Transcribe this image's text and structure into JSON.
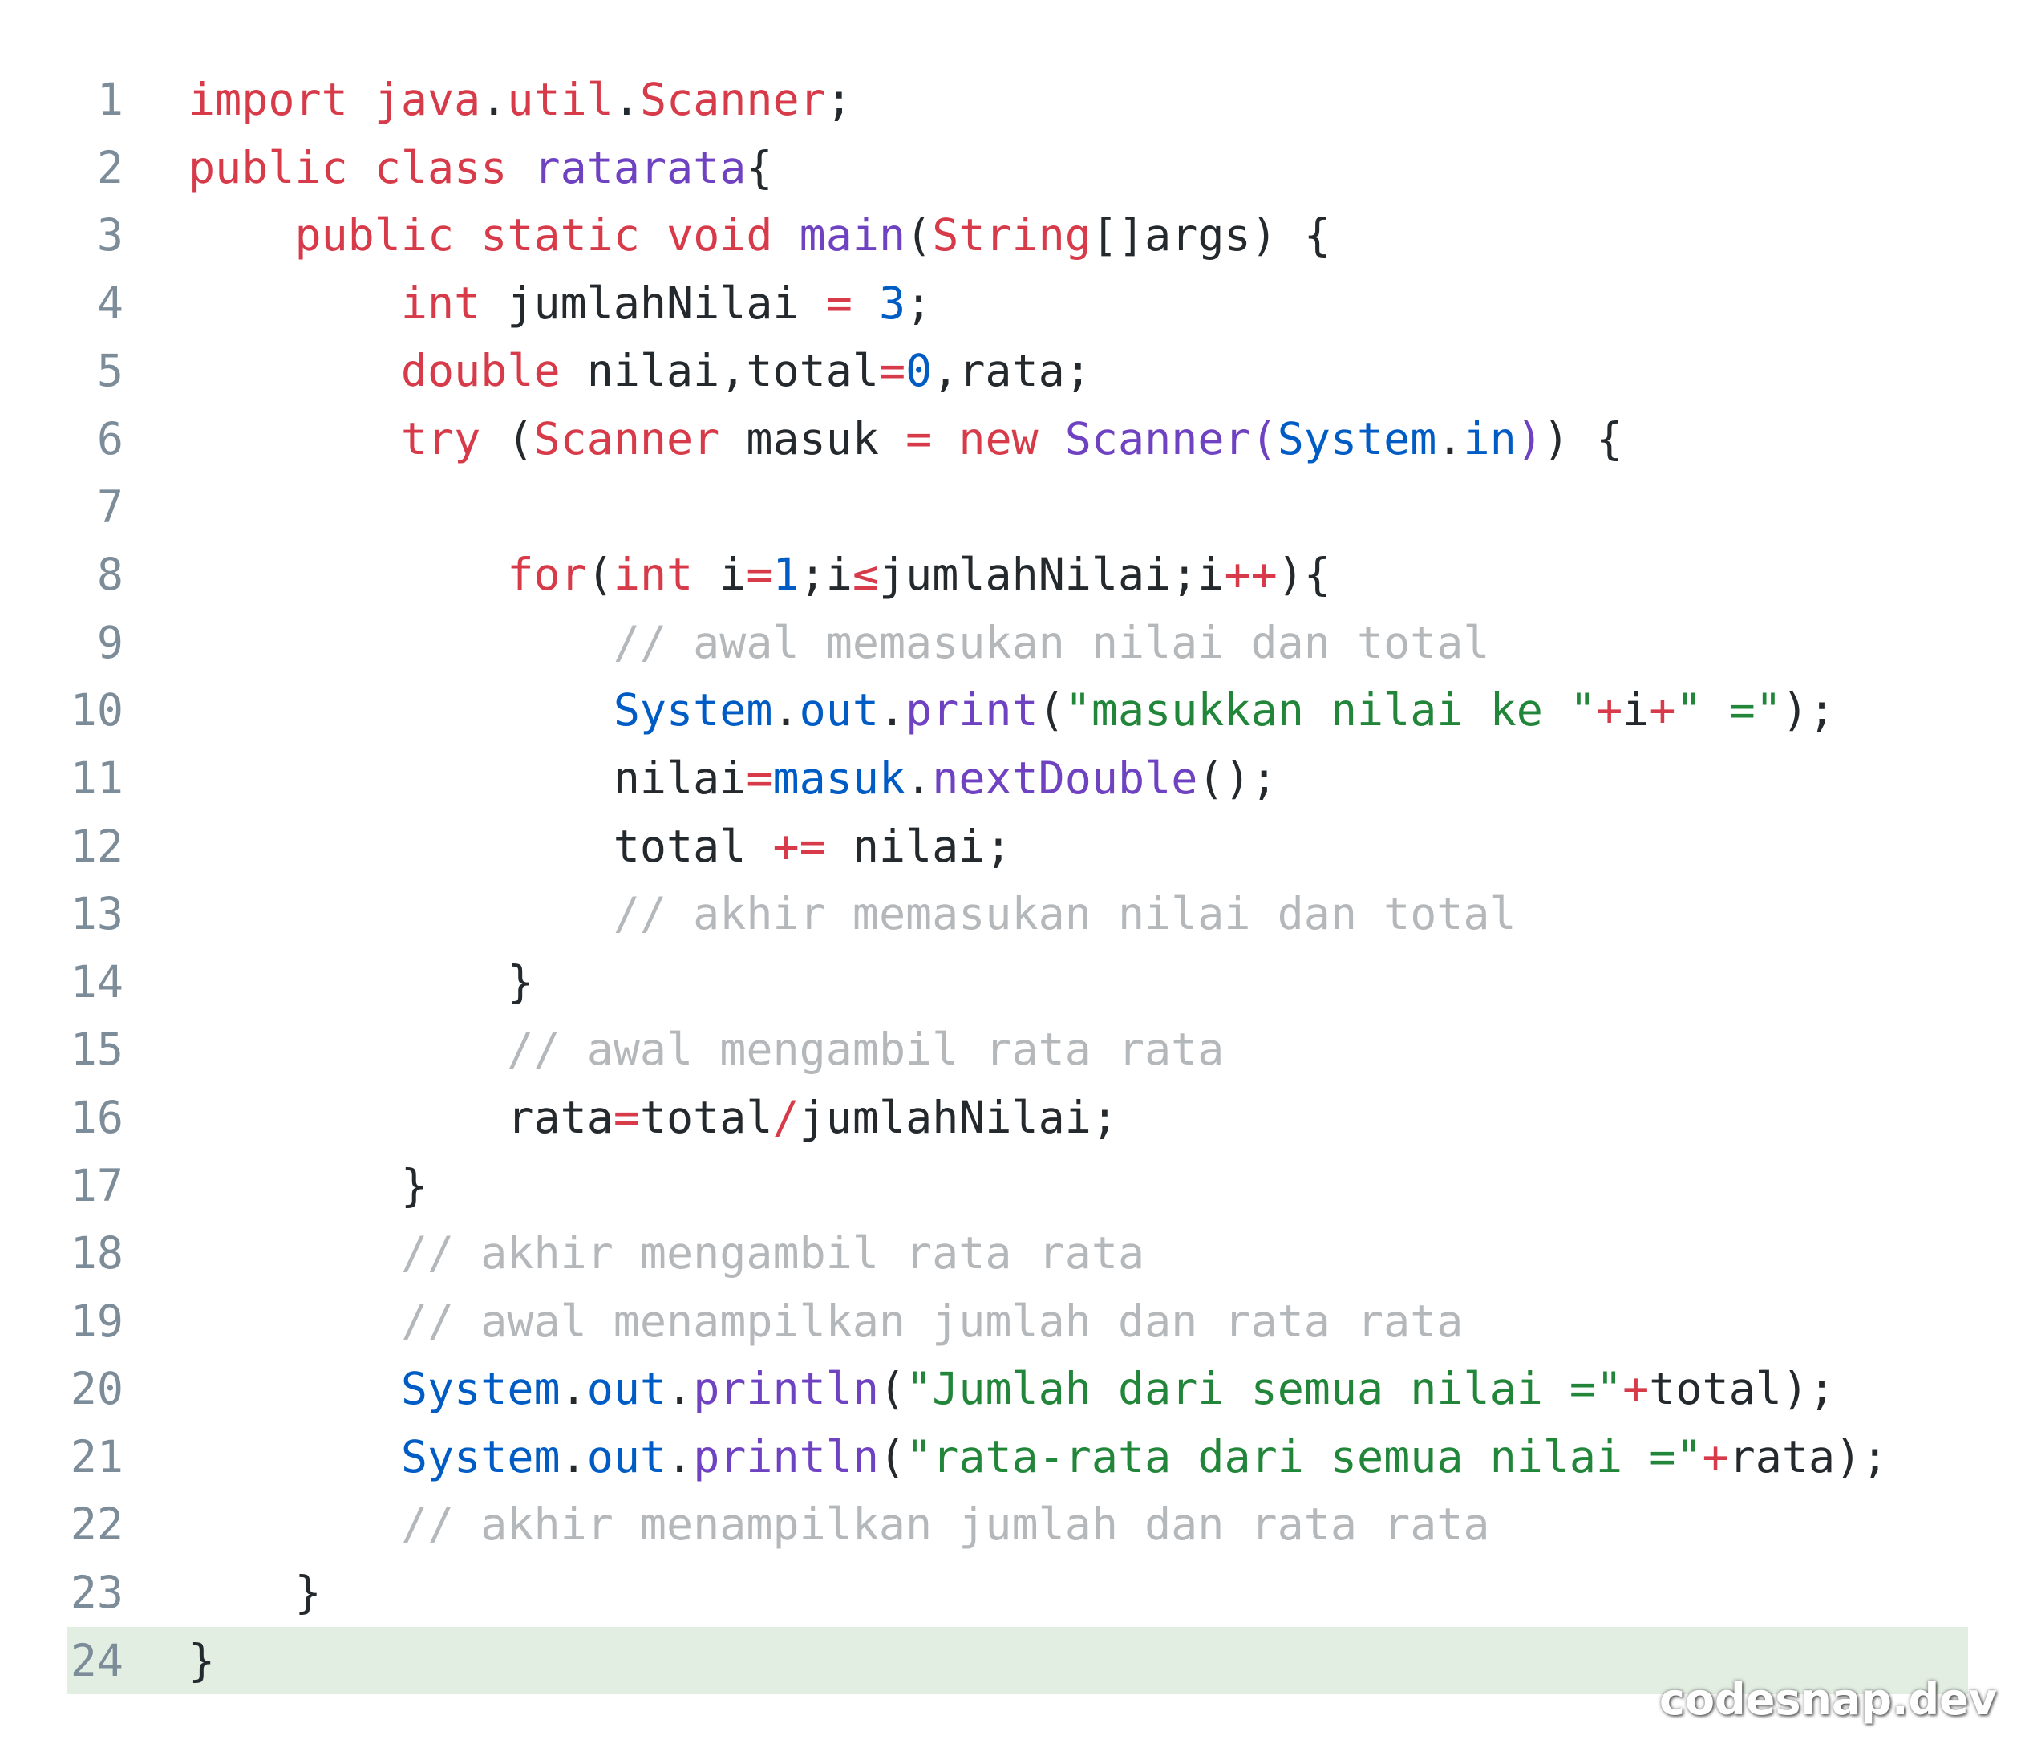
{
  "editor": {
    "highlighted_line": 24,
    "colors": {
      "keyword": "#d73a49",
      "function": "#6f42c1",
      "variable": "#005cc5",
      "string": "#22863a",
      "comment": "#b5b8bb",
      "text": "#24292e",
      "line_number": "#7d8c99",
      "highlight_bg": "#e3eee3"
    },
    "lines": [
      {
        "n": "1",
        "tokens": [
          [
            "tok-kw",
            "import"
          ],
          [
            "tok-txt",
            " "
          ],
          [
            "tok-kw",
            "java"
          ],
          [
            "tok-txt",
            "."
          ],
          [
            "tok-kw",
            "util"
          ],
          [
            "tok-txt",
            "."
          ],
          [
            "tok-kw",
            "Scanner"
          ],
          [
            "tok-txt",
            ";"
          ]
        ]
      },
      {
        "n": "2",
        "tokens": [
          [
            "tok-kw",
            "public"
          ],
          [
            "tok-txt",
            " "
          ],
          [
            "tok-kw",
            "class"
          ],
          [
            "tok-txt",
            " "
          ],
          [
            "tok-def",
            "ratarata"
          ],
          [
            "tok-txt",
            "{"
          ]
        ]
      },
      {
        "n": "3",
        "tokens": [
          [
            "tok-txt",
            "    "
          ],
          [
            "tok-kw",
            "public"
          ],
          [
            "tok-txt",
            " "
          ],
          [
            "tok-kw",
            "static"
          ],
          [
            "tok-txt",
            " "
          ],
          [
            "tok-kw",
            "void"
          ],
          [
            "tok-txt",
            " "
          ],
          [
            "tok-fn",
            "main"
          ],
          [
            "tok-txt",
            "("
          ],
          [
            "tok-type",
            "String"
          ],
          [
            "tok-txt",
            "[]args) {"
          ]
        ]
      },
      {
        "n": "4",
        "tokens": [
          [
            "tok-txt",
            "        "
          ],
          [
            "tok-kw",
            "int"
          ],
          [
            "tok-txt",
            " jumlahNilai "
          ],
          [
            "tok-op",
            "="
          ],
          [
            "tok-txt",
            " "
          ],
          [
            "tok-num",
            "3"
          ],
          [
            "tok-txt",
            ";"
          ]
        ]
      },
      {
        "n": "5",
        "tokens": [
          [
            "tok-txt",
            "        "
          ],
          [
            "tok-kw",
            "double"
          ],
          [
            "tok-txt",
            " nilai,total"
          ],
          [
            "tok-op",
            "="
          ],
          [
            "tok-num",
            "0"
          ],
          [
            "tok-txt",
            ",rata;"
          ]
        ]
      },
      {
        "n": "6",
        "tokens": [
          [
            "tok-txt",
            "        "
          ],
          [
            "tok-kw",
            "try"
          ],
          [
            "tok-txt",
            " ("
          ],
          [
            "tok-type",
            "Scanner"
          ],
          [
            "tok-txt",
            " masuk "
          ],
          [
            "tok-op",
            "="
          ],
          [
            "tok-txt",
            " "
          ],
          [
            "tok-kw",
            "new"
          ],
          [
            "tok-txt",
            " "
          ],
          [
            "tok-cls",
            "Scanner"
          ],
          [
            "tok-cls",
            "("
          ],
          [
            "tok-var",
            "System"
          ],
          [
            "tok-txt",
            "."
          ],
          [
            "tok-var",
            "in"
          ],
          [
            "tok-cls",
            ")"
          ],
          [
            "tok-txt",
            ") {"
          ]
        ]
      },
      {
        "n": "7",
        "tokens": [
          [
            "tok-txt",
            ""
          ]
        ]
      },
      {
        "n": "8",
        "tokens": [
          [
            "tok-txt",
            "            "
          ],
          [
            "tok-kw",
            "for"
          ],
          [
            "tok-txt",
            "("
          ],
          [
            "tok-kw",
            "int"
          ],
          [
            "tok-txt",
            " i"
          ],
          [
            "tok-op",
            "="
          ],
          [
            "tok-num",
            "1"
          ],
          [
            "tok-txt",
            ";i"
          ],
          [
            "tok-op",
            "≤"
          ],
          [
            "tok-txt",
            "jumlahNilai;i"
          ],
          [
            "tok-op",
            "++"
          ],
          [
            "tok-txt",
            "){"
          ]
        ]
      },
      {
        "n": "9",
        "tokens": [
          [
            "tok-txt",
            "                "
          ],
          [
            "tok-com",
            "// awal memasukan nilai dan total"
          ]
        ]
      },
      {
        "n": "10",
        "tokens": [
          [
            "tok-txt",
            "                "
          ],
          [
            "tok-var",
            "System"
          ],
          [
            "tok-txt",
            "."
          ],
          [
            "tok-var",
            "out"
          ],
          [
            "tok-txt",
            "."
          ],
          [
            "tok-fn",
            "print"
          ],
          [
            "tok-txt",
            "("
          ],
          [
            "tok-str",
            "\"masukkan nilai ke \""
          ],
          [
            "tok-op",
            "+"
          ],
          [
            "tok-txt",
            "i"
          ],
          [
            "tok-op",
            "+"
          ],
          [
            "tok-str",
            "\" =\""
          ],
          [
            "tok-txt",
            ");"
          ]
        ]
      },
      {
        "n": "11",
        "tokens": [
          [
            "tok-txt",
            "                nilai"
          ],
          [
            "tok-op",
            "="
          ],
          [
            "tok-var",
            "masuk"
          ],
          [
            "tok-txt",
            "."
          ],
          [
            "tok-fn",
            "nextDouble"
          ],
          [
            "tok-txt",
            "();"
          ]
        ]
      },
      {
        "n": "12",
        "tokens": [
          [
            "tok-txt",
            "                total "
          ],
          [
            "tok-op",
            "+="
          ],
          [
            "tok-txt",
            " nilai;"
          ]
        ]
      },
      {
        "n": "13",
        "tokens": [
          [
            "tok-txt",
            "                "
          ],
          [
            "tok-com",
            "// akhir memasukan nilai dan total"
          ]
        ]
      },
      {
        "n": "14",
        "tokens": [
          [
            "tok-txt",
            "            }"
          ]
        ]
      },
      {
        "n": "15",
        "tokens": [
          [
            "tok-txt",
            "            "
          ],
          [
            "tok-com",
            "// awal mengambil rata rata"
          ]
        ]
      },
      {
        "n": "16",
        "tokens": [
          [
            "tok-txt",
            "            rata"
          ],
          [
            "tok-op",
            "="
          ],
          [
            "tok-txt",
            "total"
          ],
          [
            "tok-op",
            "/"
          ],
          [
            "tok-txt",
            "jumlahNilai;"
          ]
        ]
      },
      {
        "n": "17",
        "tokens": [
          [
            "tok-txt",
            "        }"
          ]
        ]
      },
      {
        "n": "18",
        "tokens": [
          [
            "tok-txt",
            "        "
          ],
          [
            "tok-com",
            "// akhir mengambil rata rata"
          ]
        ]
      },
      {
        "n": "19",
        "tokens": [
          [
            "tok-txt",
            "        "
          ],
          [
            "tok-com",
            "// awal menampilkan jumlah dan rata rata"
          ]
        ]
      },
      {
        "n": "20",
        "tokens": [
          [
            "tok-txt",
            "        "
          ],
          [
            "tok-var",
            "System"
          ],
          [
            "tok-txt",
            "."
          ],
          [
            "tok-var",
            "out"
          ],
          [
            "tok-txt",
            "."
          ],
          [
            "tok-fn",
            "println"
          ],
          [
            "tok-txt",
            "("
          ],
          [
            "tok-str",
            "\"Jumlah dari semua nilai =\""
          ],
          [
            "tok-op",
            "+"
          ],
          [
            "tok-txt",
            "total);"
          ]
        ]
      },
      {
        "n": "21",
        "tokens": [
          [
            "tok-txt",
            "        "
          ],
          [
            "tok-var",
            "System"
          ],
          [
            "tok-txt",
            "."
          ],
          [
            "tok-var",
            "out"
          ],
          [
            "tok-txt",
            "."
          ],
          [
            "tok-fn",
            "println"
          ],
          [
            "tok-txt",
            "("
          ],
          [
            "tok-str",
            "\"rata-rata dari semua nilai =\""
          ],
          [
            "tok-op",
            "+"
          ],
          [
            "tok-txt",
            "rata);"
          ]
        ]
      },
      {
        "n": "22",
        "tokens": [
          [
            "tok-txt",
            "        "
          ],
          [
            "tok-com",
            "// akhir menampilkan jumlah dan rata rata"
          ]
        ]
      },
      {
        "n": "23",
        "tokens": [
          [
            "tok-txt",
            "    }"
          ]
        ]
      },
      {
        "n": "24",
        "tokens": [
          [
            "tok-txt",
            "}"
          ]
        ]
      }
    ]
  },
  "watermark": "codesnap.dev"
}
